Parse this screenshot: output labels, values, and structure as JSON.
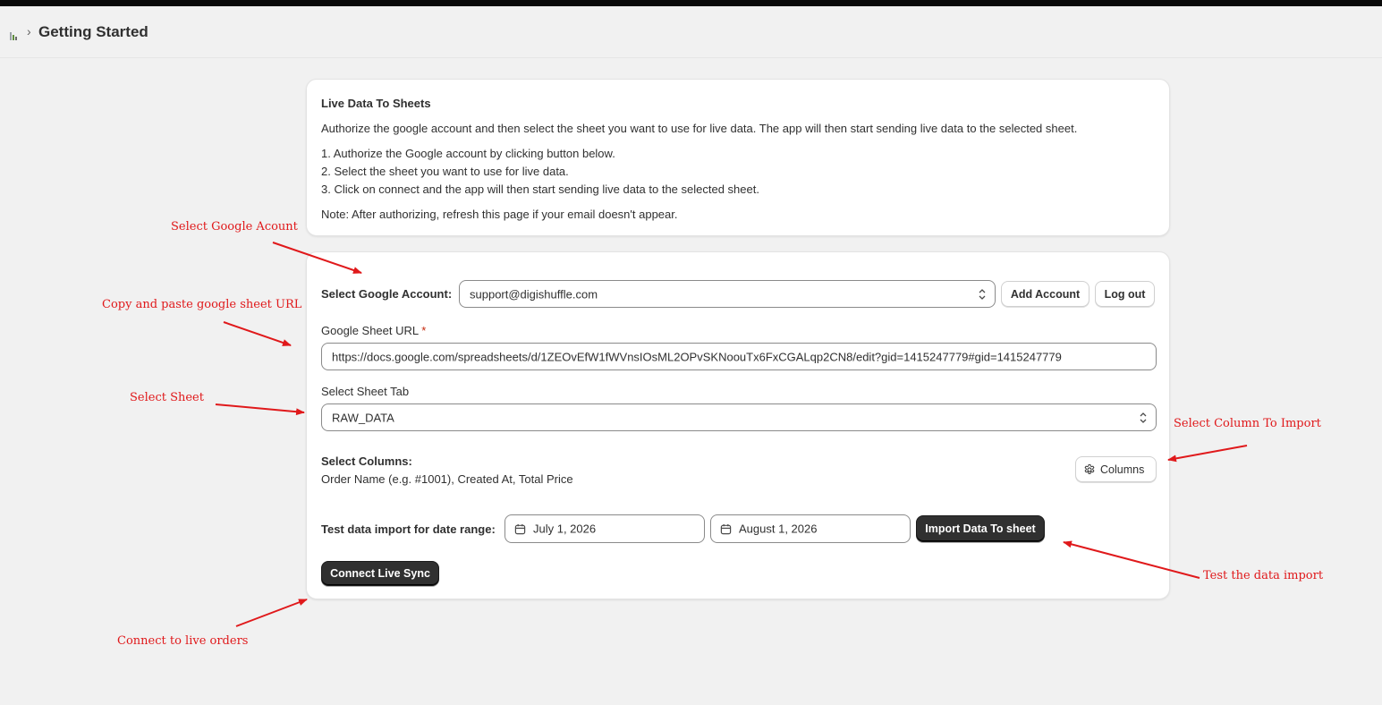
{
  "header": {
    "breadcrumb_separator": "›",
    "title": "Getting Started"
  },
  "info_card": {
    "heading": "Live Data To Sheets",
    "description": "Authorize the google account and then select the sheet you want to use for live data. The app will then start sending live data to the selected sheet.",
    "steps": [
      "1. Authorize the Google account by clicking button below.",
      "2. Select the sheet you want to use for live data.",
      "3. Click on connect and the app will then start sending live data to the selected sheet."
    ],
    "note": "Note: After authorizing, refresh this page if your email doesn't appear."
  },
  "form": {
    "account_label": "Select Google Account:",
    "account_value": "support@digishuffle.com",
    "add_account_label": "Add Account",
    "logout_label": "Log out",
    "sheet_url_label": "Google Sheet URL",
    "required_marker": "*",
    "sheet_url_value": "https://docs.google.com/spreadsheets/d/1ZEOvEfW1fWVnsIOsML2OPvSKNoouTx6FxCGALqp2CN8/edit?gid=1415247779#gid=1415247779",
    "sheet_tab_label": "Select Sheet Tab",
    "sheet_tab_value": "RAW_DATA",
    "columns_label": "Select Columns:",
    "columns_value": "Order Name (e.g. #1001), Created At, Total Price",
    "columns_button_label": "Columns",
    "date_range_label": "Test data import for date range:",
    "start_date": "July 1, 2026",
    "end_date": "August 1, 2026",
    "import_button_label": "Import Data To sheet",
    "connect_button_label": "Connect Live Sync"
  },
  "annotations": {
    "select_account": "Select Google Acount",
    "copy_url": "Copy and paste google sheet URL",
    "select_sheet": "Select Sheet",
    "select_column": "Select Column To Import",
    "test_import": "Test the data import",
    "connect_live": "Connect to live orders"
  },
  "colors": {
    "annotation": "#e0191b",
    "primary_button": "#303030",
    "page_background": "#f1f1f1"
  }
}
